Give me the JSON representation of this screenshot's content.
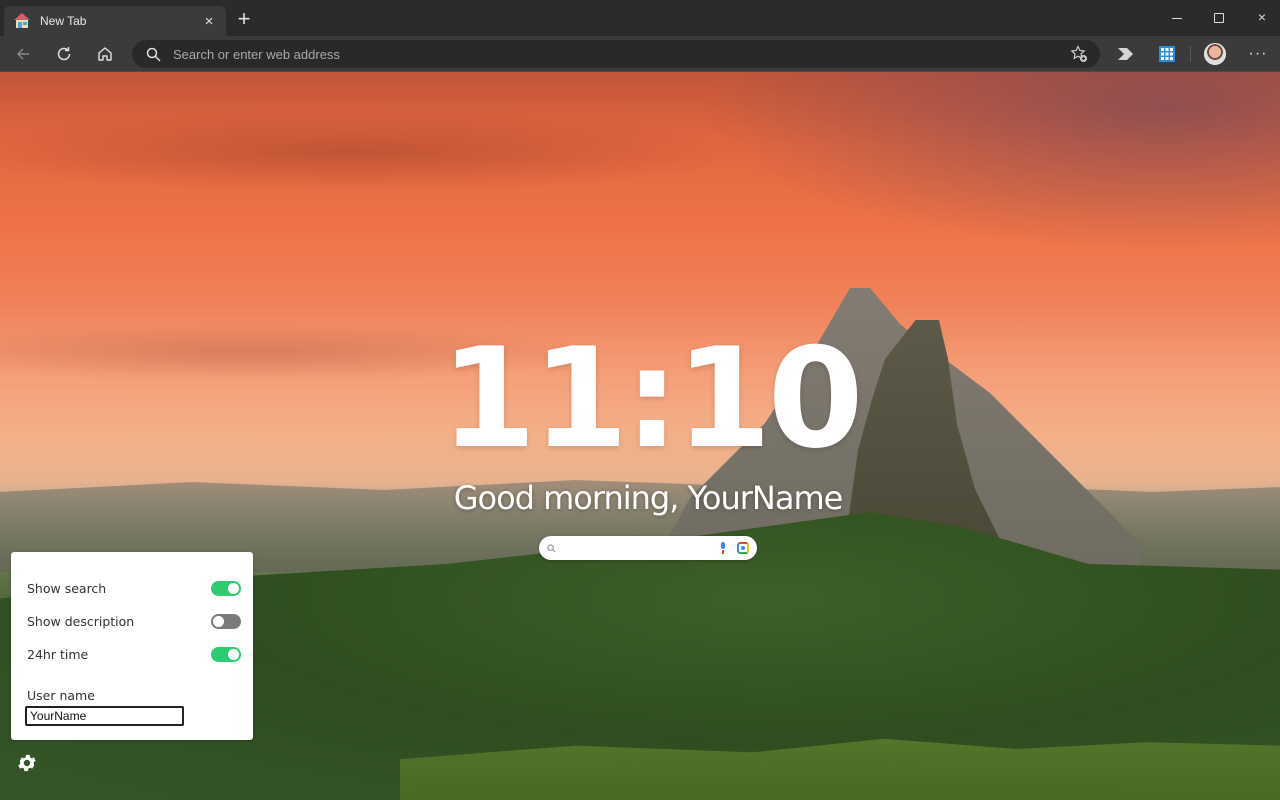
{
  "browser": {
    "tab": {
      "title": "New Tab",
      "favicon": "house-icon",
      "close_icon": "×"
    },
    "new_tab_icon": "+",
    "window_controls": {
      "minimize": "minimize-icon",
      "maximize": "maximize-icon",
      "close": "×"
    },
    "toolbar": {
      "back_icon": "back-arrow-icon",
      "reload_icon": "reload-icon",
      "home_icon": "home-icon",
      "address_placeholder": "Search or enter web address",
      "address_value": "",
      "favorites_icon": "star-add-icon",
      "extensions": [
        "arrow-extension-icon",
        "grid-extension-icon"
      ],
      "profile": "avatar",
      "more_icon": "···"
    }
  },
  "newtab": {
    "clock": "11:10",
    "greeting": "Good morning, YourName",
    "search": {
      "placeholder": "",
      "value": ""
    },
    "accent_colors": {
      "toggle_on": "#2ecc71",
      "toggle_off": "#7a7a7a"
    }
  },
  "settings": {
    "toggles": [
      {
        "label": "Show search",
        "on": true
      },
      {
        "label": "Show description",
        "on": false
      },
      {
        "label": "24hr time",
        "on": true
      }
    ],
    "username_label": "User name",
    "username_value": "YourName",
    "gear_icon": "gear-icon"
  }
}
